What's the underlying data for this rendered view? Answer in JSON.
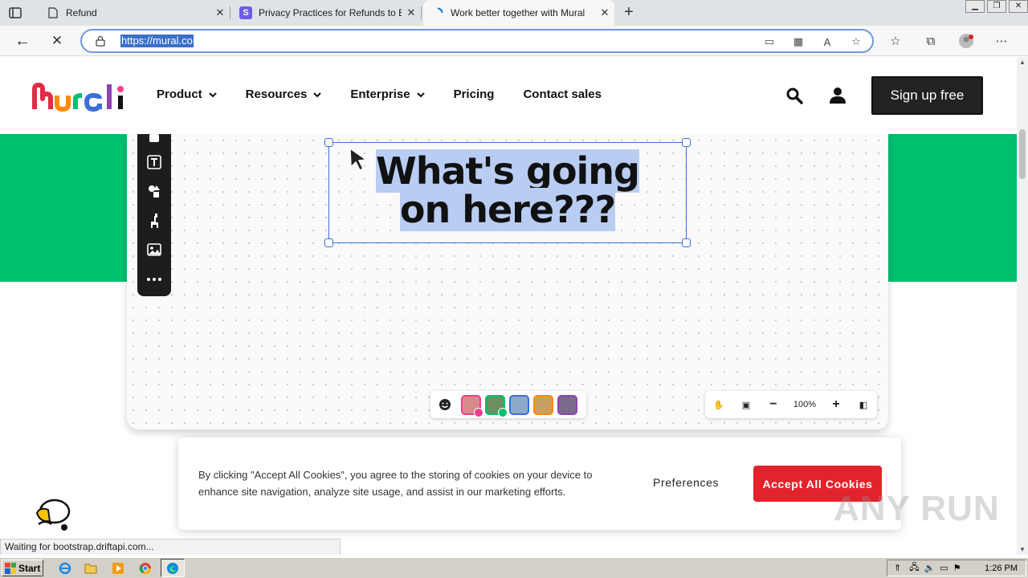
{
  "browser": {
    "tabs": [
      {
        "title": "Refund",
        "close": "✕"
      },
      {
        "title": "Privacy Practices for Refunds to E",
        "close": "✕"
      },
      {
        "title": "Work better together with Mural",
        "close": "✕"
      }
    ],
    "new_tab": "+",
    "url": "https://mural.co",
    "status": "Waiting for bootstrap.driftapi.com..."
  },
  "site": {
    "nav": [
      {
        "label": "Product"
      },
      {
        "label": "Resources"
      },
      {
        "label": "Enterprise"
      },
      {
        "label": "Pricing"
      },
      {
        "label": "Contact sales"
      }
    ],
    "signup_label": "Sign up free",
    "brand_colors": {
      "green": "#00bf6f",
      "accept_red": "#e3232b",
      "selection_blue": "#3b6fd8"
    }
  },
  "board": {
    "sticky_line1": "What's going",
    "sticky_line2": "on here???",
    "zoom": "100%"
  },
  "cookie": {
    "message": "By clicking \"Accept All Cookies\", you agree to the storing of cookies on your device to enhance site navigation, analyze site usage, and assist in our marketing efforts.",
    "preferences": "Preferences",
    "accept": "Accept All Cookies"
  },
  "taskbar": {
    "start": "Start",
    "time": "1:26 PM"
  },
  "watermark": "ANY RUN"
}
